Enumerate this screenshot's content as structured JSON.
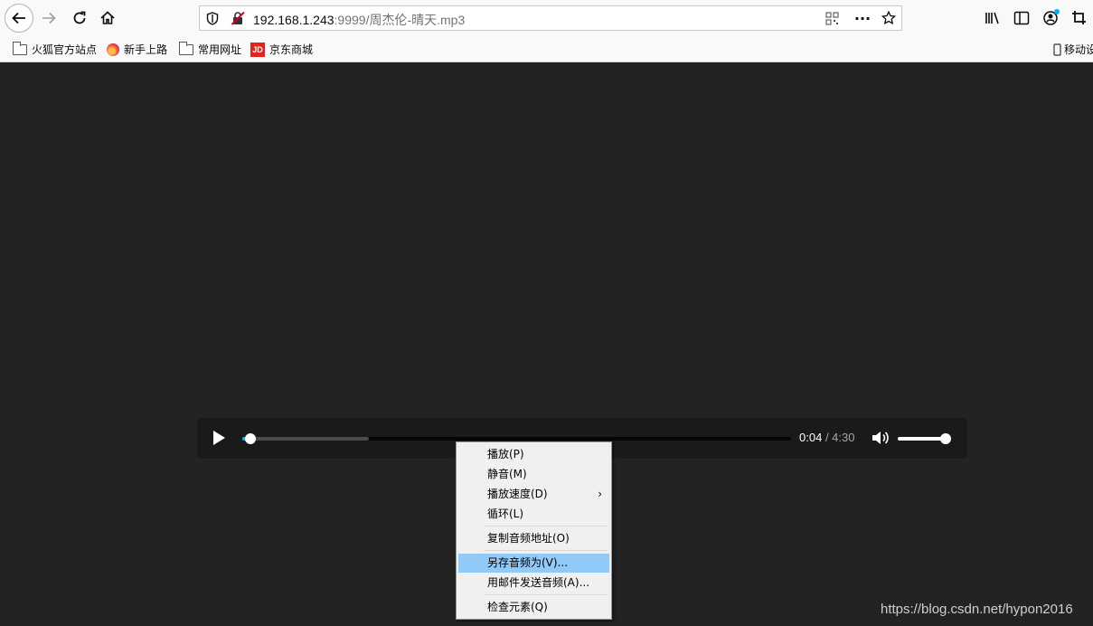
{
  "browser": {
    "url_host": "192.168.1.243",
    "url_rest": ":9999/周杰伦-晴天.mp3",
    "bookmarks": [
      {
        "label": "火狐官方站点",
        "icon": "folder-icon"
      },
      {
        "label": "新手上路",
        "icon": "firefox-icon"
      },
      {
        "label": "常用网址",
        "icon": "folder-icon"
      },
      {
        "label": "京东商城",
        "icon": "jd-icon"
      }
    ],
    "jd_logo_text": "JD",
    "mobile_bookmarks": "移动设"
  },
  "player": {
    "current_time": "0:04",
    "duration": "/ 4:30",
    "progress_fraction": 0.015,
    "buffered_fraction": 0.23,
    "volume_fraction": 1.0,
    "accent_color": "#00b6f0"
  },
  "context_menu": {
    "items": [
      {
        "label": "播放(P)"
      },
      {
        "label": "静音(M)"
      },
      {
        "label": "播放速度(D)",
        "submenu": true
      },
      {
        "label": "循环(L)"
      },
      {
        "label": "复制音频地址(O)"
      },
      {
        "label": "另存音频为(V)...",
        "highlighted": true
      },
      {
        "label": "用邮件发送音频(A)..."
      },
      {
        "label": "检查元素(Q)"
      }
    ],
    "submenu_arrow": "›"
  },
  "watermark": "https://blog.csdn.net/hypon2016"
}
